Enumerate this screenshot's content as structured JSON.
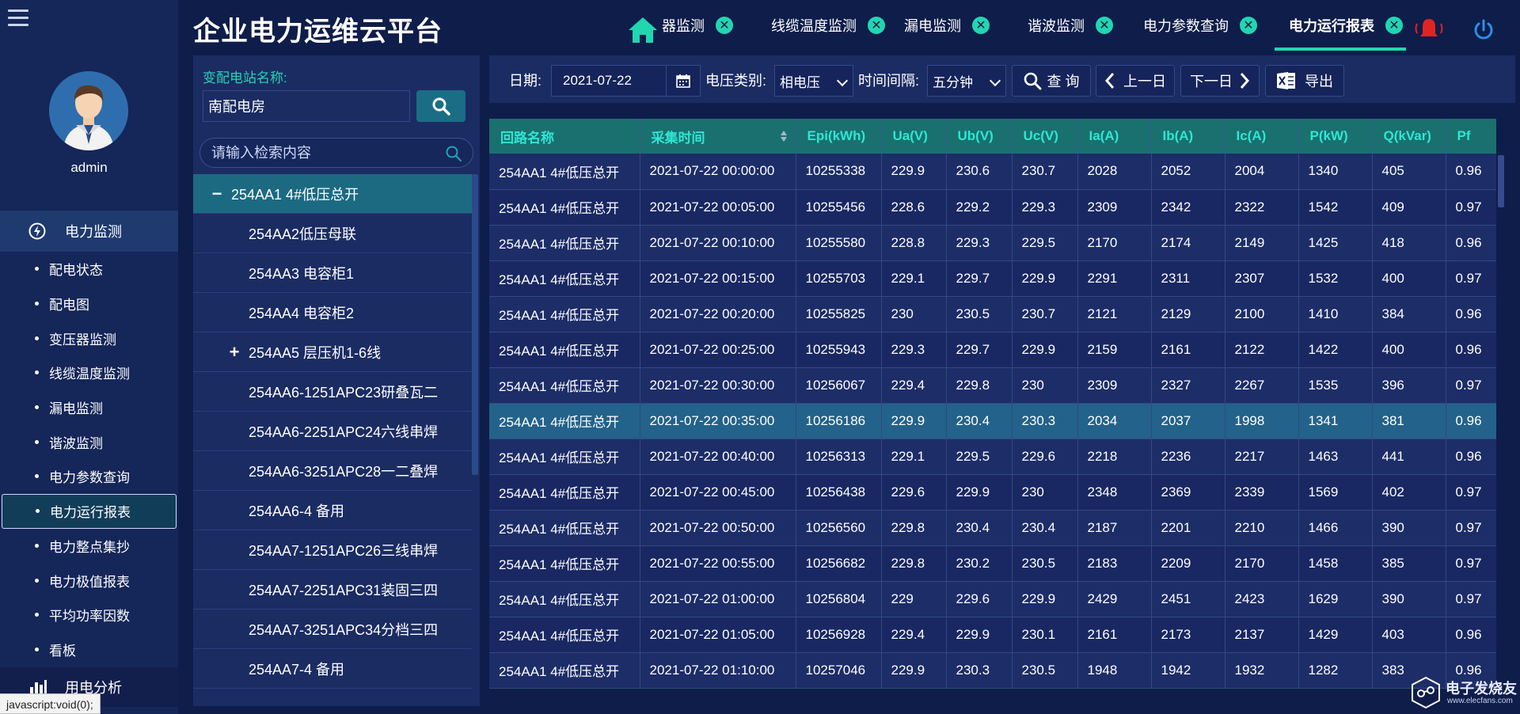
{
  "app": {
    "title": "企业电力运维云平台"
  },
  "user": {
    "name": "admin"
  },
  "sidebar": {
    "group_label": "电力监测",
    "items": [
      {
        "label": "配电状态",
        "active": false
      },
      {
        "label": "配电图",
        "active": false
      },
      {
        "label": "变压器监测",
        "active": false
      },
      {
        "label": "线缆温度监测",
        "active": false
      },
      {
        "label": "漏电监测",
        "active": false
      },
      {
        "label": "谐波监测",
        "active": false
      },
      {
        "label": "电力参数查询",
        "active": false
      },
      {
        "label": "电力运行报表",
        "active": true
      },
      {
        "label": "电力整点集抄",
        "active": false
      },
      {
        "label": "电力极值报表",
        "active": false
      },
      {
        "label": "平均功率因数",
        "active": false
      },
      {
        "label": "看板",
        "active": false
      }
    ],
    "group2_label": "用电分析"
  },
  "status_tip": "javascript:void(0);",
  "tabs": [
    {
      "label": "器监测",
      "active": false
    },
    {
      "label": "线缆温度监测",
      "active": false
    },
    {
      "label": "漏电监测",
      "active": false
    },
    {
      "label": "谐波监测",
      "active": false
    },
    {
      "label": "电力参数查询",
      "active": false
    },
    {
      "label": "电力运行报表",
      "active": true
    }
  ],
  "station": {
    "label": "变配电站名称:",
    "value": "南配电房",
    "search_placeholder": "请输入检索内容"
  },
  "tree": [
    {
      "label": "254AA1 4#低压总开",
      "marker": "−",
      "selected": true,
      "type": "root"
    },
    {
      "label": "254AA2低压母联",
      "marker": "",
      "selected": false,
      "type": "leaf"
    },
    {
      "label": "254AA3 电容柜1",
      "marker": "",
      "selected": false,
      "type": "leaf"
    },
    {
      "label": "254AA4 电容柜2",
      "marker": "",
      "selected": false,
      "type": "leaf"
    },
    {
      "label": "254AA5 层压机1-6线",
      "marker": "+",
      "selected": false,
      "type": "branch"
    },
    {
      "label": "254AA6-1251APC23研叠瓦二",
      "marker": "",
      "selected": false,
      "type": "leaf"
    },
    {
      "label": "254AA6-2251APC24六线串焊",
      "marker": "",
      "selected": false,
      "type": "leaf"
    },
    {
      "label": "254AA6-3251APC28一二叠焊",
      "marker": "",
      "selected": false,
      "type": "leaf"
    },
    {
      "label": "254AA6-4 备用",
      "marker": "",
      "selected": false,
      "type": "leaf"
    },
    {
      "label": "254AA7-1251APC26三线串焊",
      "marker": "",
      "selected": false,
      "type": "leaf"
    },
    {
      "label": "254AA7-2251APC31装固三四",
      "marker": "",
      "selected": false,
      "type": "leaf"
    },
    {
      "label": "254AA7-3251APC34分档三四",
      "marker": "",
      "selected": false,
      "type": "leaf"
    },
    {
      "label": "254AA7-4 备用",
      "marker": "",
      "selected": false,
      "type": "leaf"
    }
  ],
  "toolbar": {
    "date_label": "日期:",
    "date_value": "2021-07-22",
    "voltage_label": "电压类别:",
    "voltage_value": "相电压",
    "interval_label": "时间间隔:",
    "interval_value": "五分钟",
    "query_label": "查 询",
    "prev_label": "上一日",
    "next_label": "下一日",
    "export_label": "导出"
  },
  "table": {
    "columns": [
      "回路名称",
      "采集时间",
      "Epi(kWh)",
      "Ua(V)",
      "Ub(V)",
      "Uc(V)",
      "Ia(A)",
      "Ib(A)",
      "Ic(A)",
      "P(kW)",
      "Q(kVar)",
      "Pf"
    ],
    "highlight_row": 7,
    "rows": [
      [
        "254AA1 4#低压总开",
        "2021-07-22 00:00:00",
        "10255338",
        "229.9",
        "230.6",
        "230.7",
        "2028",
        "2052",
        "2004",
        "1340",
        "405",
        "0.96"
      ],
      [
        "254AA1 4#低压总开",
        "2021-07-22 00:05:00",
        "10255456",
        "228.6",
        "229.2",
        "229.3",
        "2309",
        "2342",
        "2322",
        "1542",
        "409",
        "0.97"
      ],
      [
        "254AA1 4#低压总开",
        "2021-07-22 00:10:00",
        "10255580",
        "228.8",
        "229.3",
        "229.5",
        "2170",
        "2174",
        "2149",
        "1425",
        "418",
        "0.96"
      ],
      [
        "254AA1 4#低压总开",
        "2021-07-22 00:15:00",
        "10255703",
        "229.1",
        "229.7",
        "229.9",
        "2291",
        "2311",
        "2307",
        "1532",
        "400",
        "0.97"
      ],
      [
        "254AA1 4#低压总开",
        "2021-07-22 00:20:00",
        "10255825",
        "230",
        "230.5",
        "230.7",
        "2121",
        "2129",
        "2100",
        "1410",
        "384",
        "0.96"
      ],
      [
        "254AA1 4#低压总开",
        "2021-07-22 00:25:00",
        "10255943",
        "229.3",
        "229.7",
        "229.9",
        "2159",
        "2161",
        "2122",
        "1422",
        "400",
        "0.96"
      ],
      [
        "254AA1 4#低压总开",
        "2021-07-22 00:30:00",
        "10256067",
        "229.4",
        "229.8",
        "230",
        "2309",
        "2327",
        "2267",
        "1535",
        "396",
        "0.97"
      ],
      [
        "254AA1 4#低压总开",
        "2021-07-22 00:35:00",
        "10256186",
        "229.9",
        "230.4",
        "230.3",
        "2034",
        "2037",
        "1998",
        "1341",
        "381",
        "0.96"
      ],
      [
        "254AA1 4#低压总开",
        "2021-07-22 00:40:00",
        "10256313",
        "229.1",
        "229.5",
        "229.6",
        "2218",
        "2236",
        "2217",
        "1463",
        "441",
        "0.96"
      ],
      [
        "254AA1 4#低压总开",
        "2021-07-22 00:45:00",
        "10256438",
        "229.6",
        "229.9",
        "230",
        "2348",
        "2369",
        "2339",
        "1569",
        "402",
        "0.97"
      ],
      [
        "254AA1 4#低压总开",
        "2021-07-22 00:50:00",
        "10256560",
        "229.8",
        "230.4",
        "230.4",
        "2187",
        "2201",
        "2210",
        "1466",
        "390",
        "0.97"
      ],
      [
        "254AA1 4#低压总开",
        "2021-07-22 00:55:00",
        "10256682",
        "229.8",
        "230.2",
        "230.5",
        "2183",
        "2209",
        "2170",
        "1458",
        "385",
        "0.97"
      ],
      [
        "254AA1 4#低压总开",
        "2021-07-22 01:00:00",
        "10256804",
        "229",
        "229.6",
        "229.9",
        "2429",
        "2451",
        "2423",
        "1629",
        "390",
        "0.97"
      ],
      [
        "254AA1 4#低压总开",
        "2021-07-22 01:05:00",
        "10256928",
        "229.4",
        "229.9",
        "230.1",
        "2161",
        "2173",
        "2137",
        "1429",
        "403",
        "0.96"
      ],
      [
        "254AA1 4#低压总开",
        "2021-07-22 01:10:00",
        "10257046",
        "229.9",
        "230.3",
        "230.5",
        "1948",
        "1942",
        "1932",
        "1282",
        "383",
        "0.96"
      ]
    ]
  },
  "watermark": {
    "name": "电子发烧友",
    "url": "www.elecfans.com"
  },
  "colors": {
    "accent": "#21d6b1",
    "header_bg": "#19706f",
    "alarm": "#e02424"
  }
}
